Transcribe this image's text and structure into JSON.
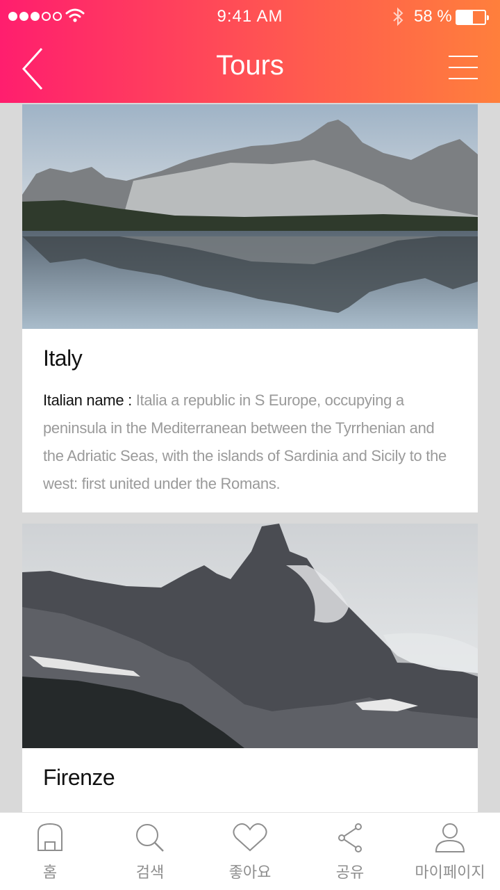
{
  "status_bar": {
    "time": "9:41 AM",
    "battery_percent": "58 %",
    "battery_level": 0.58
  },
  "header": {
    "title": "Tours"
  },
  "cards": [
    {
      "title": "Italy",
      "label": "Italian name : ",
      "description": "Italia a republic in S Europe, occupying a peninsula in the Mediterranean between the Tyrrhenian and the Adriatic Seas, with the islands of Sardinia and Sicily to the west: first united under the Romans."
    },
    {
      "title": "Firenze"
    }
  ],
  "tabbar": {
    "items": [
      {
        "label": "홈",
        "icon": "home-icon"
      },
      {
        "label": "검색",
        "icon": "search-icon"
      },
      {
        "label": "좋아요",
        "icon": "heart-icon"
      },
      {
        "label": "공유",
        "icon": "share-icon"
      },
      {
        "label": "마이페이지",
        "icon": "user-icon"
      }
    ]
  },
  "colors": {
    "gradient_start": "#ff1e6e",
    "gradient_end": "#ff7f3c",
    "muted_text": "#9a9a9a"
  }
}
